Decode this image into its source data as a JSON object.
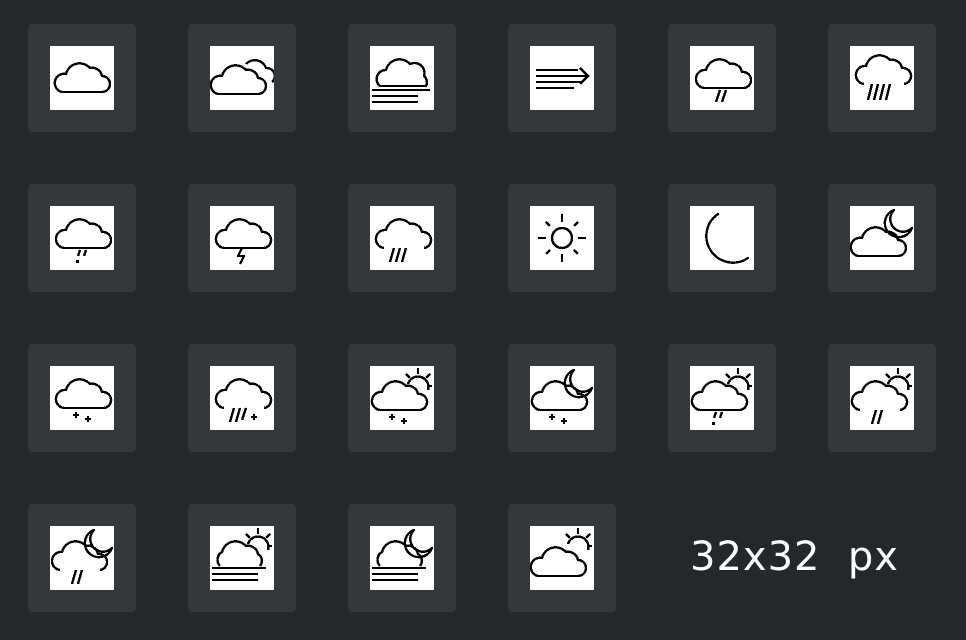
{
  "size_label": "32x32  px",
  "icons": [
    "cloud-icon",
    "cloudy-icon",
    "fog-icon",
    "wind-icon",
    "drizzle-icon",
    "heavy-rain-icon",
    "sleet-icon",
    "thunderstorm-icon",
    "rain-icon",
    "sun-icon",
    "moon-icon",
    "partly-cloudy-night-icon",
    "snow-icon",
    "rain-snow-icon",
    "snow-day-icon",
    "snow-night-icon",
    "sleet-day-icon",
    "rain-day-icon",
    "rain-night-icon",
    "fog-day-icon",
    "fog-night-icon",
    "partly-cloudy-day-icon"
  ]
}
